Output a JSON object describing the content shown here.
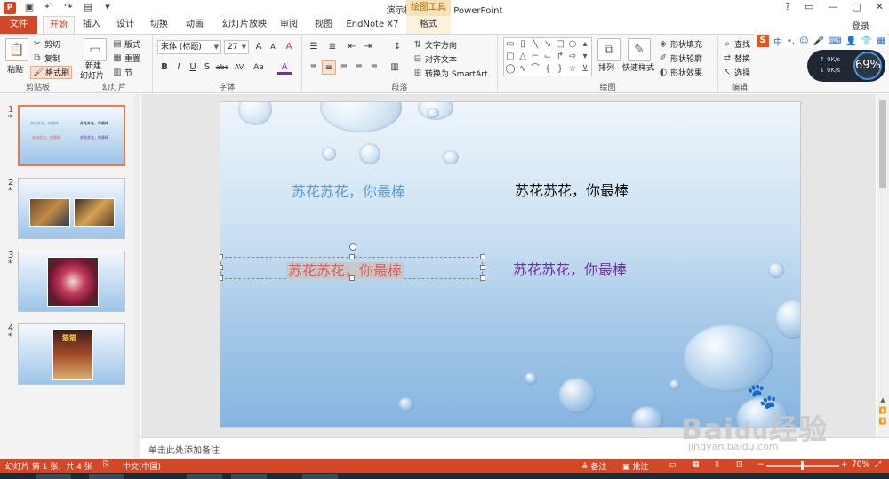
{
  "window": {
    "title": "演示模板.pptx - PowerPoint",
    "context_title": "绘图工具",
    "app_icon": "P",
    "quick_access": [
      "save-icon",
      "undo-icon",
      "redo-icon",
      "start-icon",
      "customize-icon"
    ],
    "window_buttons": [
      "?",
      "▭",
      "—",
      "▢",
      "✕"
    ]
  },
  "tabs": {
    "file": "文件",
    "home": "开始",
    "insert": "插入",
    "design": "设计",
    "transitions": "切换",
    "animations": "动画",
    "slideshow": "幻灯片放映",
    "review": "审阅",
    "view": "视图",
    "endnote": "EndNote X7",
    "format": "格式",
    "login": "登录"
  },
  "ribbon": {
    "clipboard": {
      "label": "剪贴板",
      "paste": "粘贴",
      "cut": "剪切",
      "copy": "复制",
      "format_painter": "格式刷"
    },
    "slides": {
      "label": "幻灯片",
      "new_slide": "新建",
      "new_slide2": "幻灯片",
      "layout": "版式",
      "reset": "重置",
      "section": "节"
    },
    "font": {
      "label": "字体",
      "font_name": "宋体 (标题)",
      "font_size": "27",
      "grow": "A",
      "shrink": "A",
      "clear": "A",
      "bold": "B",
      "italic": "I",
      "underline": "U",
      "shadow": "S",
      "strike": "abc",
      "spacing": "AV",
      "case": "Aa",
      "color": "A"
    },
    "paragraph": {
      "label": "段落",
      "text_direction": "文字方向",
      "align_text": "对齐文本",
      "smartart": "转换为 SmartArt"
    },
    "drawing": {
      "label": "绘图",
      "arrange": "排列",
      "quick_styles": "快速样式",
      "shape_fill": "形状填充",
      "shape_outline": "形状轮廓",
      "shape_effects": "形状效果"
    },
    "editing": {
      "label": "编辑",
      "find": "查找",
      "replace": "替换",
      "select": "选择"
    }
  },
  "ime": {
    "logo": "S",
    "lang": "中"
  },
  "speed_widget": {
    "up": "0K/s",
    "down": "0K/s",
    "percent": "69%"
  },
  "slides": [
    {
      "num": "1",
      "star": "*"
    },
    {
      "num": "2",
      "star": "*"
    },
    {
      "num": "3",
      "star": "*"
    },
    {
      "num": "4",
      "star": "*"
    }
  ],
  "thumb1": {
    "t1": "苏花苏花，你最棒",
    "t2": "苏花苏花，你最棒",
    "t3": "苏花苏花，你最棒",
    "t4": "苏花苏花，你最棒"
  },
  "thumb4": {
    "poster": "猫猫"
  },
  "slide": {
    "text_top_left": "苏花苏花，你最棒",
    "text_top_right": "苏花苏花，你最棒",
    "text_selected": "苏花苏花，你最棒",
    "text_bottom_right": "苏花苏花，你最棒",
    "colors": {
      "top_left": "#5b9bd5",
      "top_right": "#111111",
      "selected": "#e0605c",
      "bottom_right": "#7030a0"
    }
  },
  "notes": {
    "placeholder": "单击此处添加备注"
  },
  "watermark": {
    "brand": "Bai",
    "brand2": "经验",
    "url": "jingyan.baidu.com"
  },
  "status": {
    "slide_info": "幻灯片 第 1 张，共 4 张",
    "language": "中文(中国)",
    "notes_btn": "备注",
    "comments_btn": "批注",
    "zoom": "70%",
    "accent": "#d24726"
  }
}
